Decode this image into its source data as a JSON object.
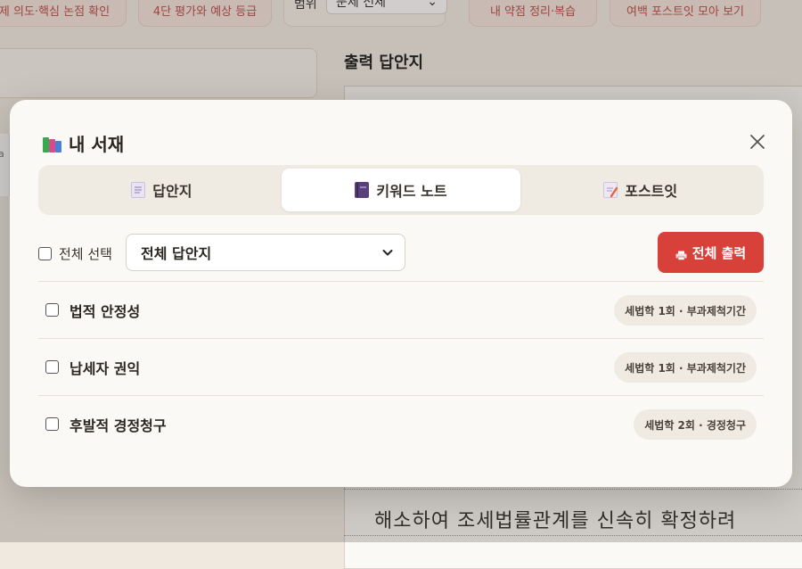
{
  "background": {
    "chips": [
      "제 의도·핵심 논점 확인",
      "4단 평가와 예상 등급",
      "내 약점 정리·복습",
      "여백 포스트잇 모아 보기"
    ],
    "scope_label": "범위",
    "scope_value": "문제 전체",
    "left_fragment": "a",
    "output_title": "출력 답안지",
    "handwriting": "해소하여 조세법률관계를 신속히 확정하려"
  },
  "modal": {
    "title": "내 서재",
    "tabs": [
      {
        "label": "답안지",
        "icon": "document-icon",
        "active": false
      },
      {
        "label": "키워드 노트",
        "icon": "notebook-icon",
        "active": true
      },
      {
        "label": "포스트잇",
        "icon": "memo-icon",
        "active": false
      }
    ],
    "select_all_label": "전체 선택",
    "filter": {
      "selected": "전체 답안지"
    },
    "print_button": "전체 출력",
    "items": [
      {
        "title": "법적 안정성",
        "badge": "세법학 1회 · 부과제척기간"
      },
      {
        "title": "납세자 권익",
        "badge": "세법학 1회 · 부과제척기간"
      },
      {
        "title": "후발적 경정청구",
        "badge": "세법학 2회 · 경정청구"
      }
    ]
  },
  "colors": {
    "accent": "#d8413a",
    "tab_bar": "#f0ebe2",
    "modal_bg": "#fbf9f5"
  }
}
